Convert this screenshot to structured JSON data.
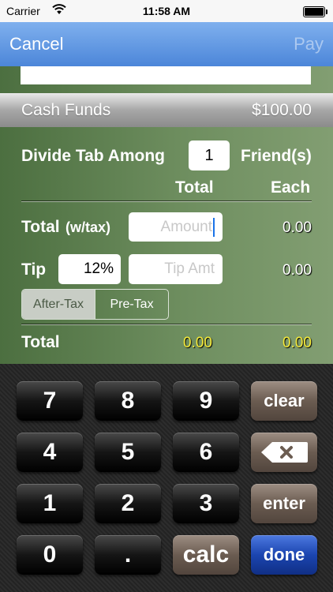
{
  "status": {
    "carrier": "Carrier",
    "time": "11:58 AM"
  },
  "nav": {
    "cancel": "Cancel",
    "pay": "Pay"
  },
  "cash": {
    "label": "Cash Funds",
    "value": "$100.00"
  },
  "divide": {
    "label": "Divide Tab Among",
    "count": "1",
    "suffix": "Friend(s)"
  },
  "headers": {
    "total": "Total",
    "each": "Each"
  },
  "total_wtax": {
    "label": "Total",
    "suffix": "(w/tax)",
    "placeholder": "Amount",
    "each": "0.00"
  },
  "tip": {
    "label": "Tip",
    "percent": "12%",
    "placeholder": "Tip Amt",
    "each": "0.00"
  },
  "tax_mode": {
    "options": [
      "After-Tax",
      "Pre-Tax"
    ],
    "selected": "After-Tax"
  },
  "grand_total": {
    "label": "Total",
    "total": "0.00",
    "each": "0.00"
  },
  "keypad": {
    "keys": [
      "7",
      "8",
      "9",
      "clear",
      "4",
      "5",
      "6",
      "delete",
      "1",
      "2",
      "3",
      "enter",
      "0",
      ".",
      "calc",
      "done"
    ]
  },
  "colors": {
    "highlight": "#f4ea3a",
    "nav_blue": "#5a92e0",
    "done_blue": "#1d49b8"
  }
}
